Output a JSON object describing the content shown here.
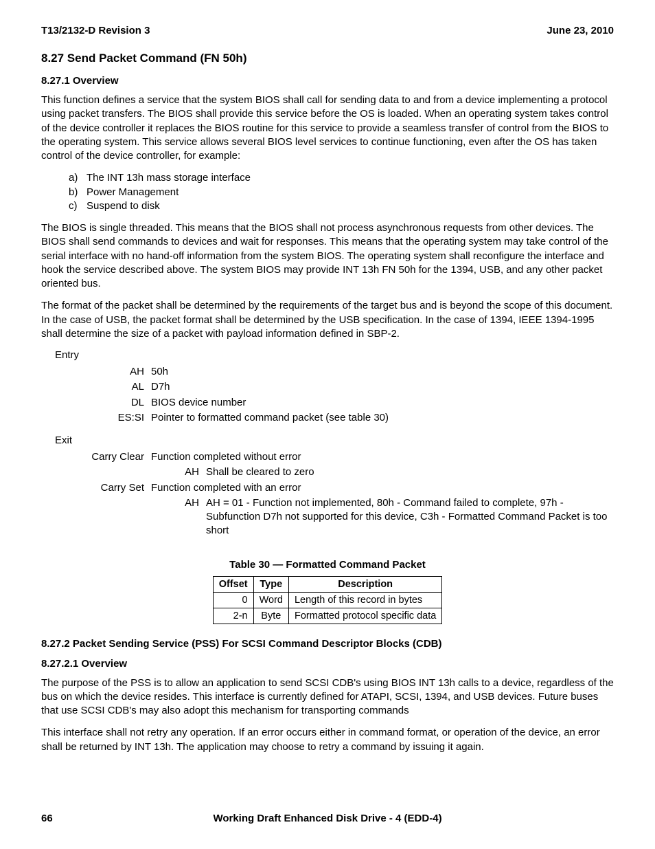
{
  "header": {
    "left": "T13/2132-D Revision 3",
    "right": "June 23, 2010"
  },
  "section": {
    "title": "8.27 Send Packet Command (FN 50h)",
    "overview_title": "8.27.1 Overview",
    "p1": "This function defines a service that the system BIOS shall call for sending data to and from a device implementing a protocol using packet transfers.  The BIOS shall provide this service before the OS is loaded.  When an operating system takes control of the device controller it replaces the BIOS routine for this service to provide a seamless transfer of control from the BIOS to the operating system.  This service allows several BIOS level services to continue functioning, even after the OS has taken control of the device controller, for example:",
    "list": {
      "a": "The INT 13h mass storage interface",
      "b": "Power Management",
      "c": "Suspend to disk"
    },
    "p2": "The BIOS is single threaded.  This means that the BIOS shall not process asynchronous requests from other devices.  The BIOS shall send commands to devices and wait for responses.  This means that the operating system  may take control of the serial interface with no hand-off information from the system BIOS.  The operating system shall reconfigure the interface and hook the service described above.  The system BIOS may provide INT 13h FN 50h for the 1394, USB, and any other packet oriented bus.",
    "p3": "The format of the packet shall be determined by the requirements of the target bus and is beyond the scope of this document.  In the case of USB, the packet format shall be determined by the USB specification.  In the case of 1394, IEEE 1394-1995 shall determine the size of a packet with payload information defined in SBP-2."
  },
  "entry": {
    "label": "Entry",
    "AH": "50h",
    "AL": "D7h",
    "DL": "BIOS device number",
    "ESSI": "Pointer to formatted command packet (see table 30)"
  },
  "exit": {
    "label": "Exit",
    "carry_clear_label": "Carry Clear",
    "carry_clear_text": "Function completed without error",
    "cc_ah_label": "AH",
    "cc_ah_text": "Shall be cleared to zero",
    "carry_set_label": "Carry Set",
    "carry_set_text": "Function completed with an error",
    "cs_ah_label": "AH",
    "cs_ah_text": "AH = 01 - Function not implemented, 80h - Command failed to complete, 97h - Subfunction D7h not supported for this device, C3h - Formatted Command Packet is too short"
  },
  "table": {
    "caption": "Table 30 — Formatted Command Packet",
    "headers": {
      "c1": "Offset",
      "c2": "Type",
      "c3": "Description"
    },
    "rows": [
      {
        "offset": "0",
        "type": "Word",
        "desc": "Length of this record in bytes"
      },
      {
        "offset": "2-n",
        "type": "Byte",
        "desc": "Formatted protocol specific data"
      }
    ]
  },
  "sub": {
    "title": "8.27.2 Packet Sending Service (PSS) For SCSI Command Descriptor Blocks (CDB)",
    "ov_title": "8.27.2.1 Overview",
    "p1": "The purpose of the PSS is to allow an application to send SCSI CDB's using BIOS INT 13h calls to a device, regardless of the bus on which the device resides.  This interface is currently defined for ATAPI, SCSI, 1394, and USB devices.  Future buses that use SCSI CDB's may also adopt this mechanism for transporting commands",
    "p2": "This interface shall not retry any operation.  If an error occurs either in command format, or operation of the device, an error shall be returned by INT 13h.  The application may choose to retry a command by issuing it again."
  },
  "footer": {
    "page": "66",
    "center": "Working Draft Enhanced Disk Drive - 4  (EDD-4)"
  },
  "labels": {
    "AH": "AH",
    "AL": "AL",
    "DL": "DL",
    "ESSI": "ES:SI",
    "a": "a)",
    "b": "b)",
    "c": "c)"
  }
}
